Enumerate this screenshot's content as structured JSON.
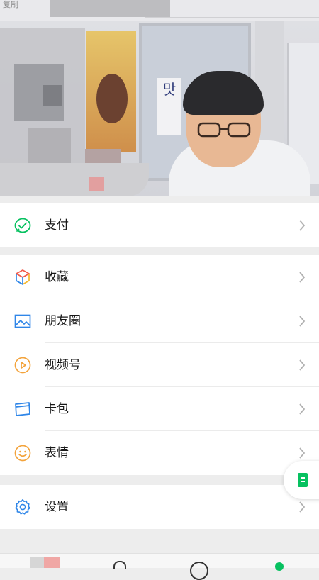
{
  "header": {
    "tip_text": "复制"
  },
  "menu": {
    "pay": {
      "label": "支付"
    },
    "favorites": {
      "label": "收藏"
    },
    "moments": {
      "label": "朋友圈"
    },
    "channels": {
      "label": "视频号"
    },
    "cards": {
      "label": "卡包"
    },
    "stickers": {
      "label": "表情"
    },
    "settings": {
      "label": "设置"
    }
  },
  "colors": {
    "accent": "#07c160",
    "background": "#ededed",
    "row_bg": "#ffffff",
    "text": "#181818",
    "chevron": "#b2b2b2"
  },
  "icons": {
    "pay": "wechat-pay-icon",
    "favorites": "favorites-cube-icon",
    "moments": "moments-picture-icon",
    "channels": "channels-play-icon",
    "cards": "card-wallet-icon",
    "stickers": "smiley-icon",
    "settings": "gear-icon",
    "floating": "document-icon"
  }
}
